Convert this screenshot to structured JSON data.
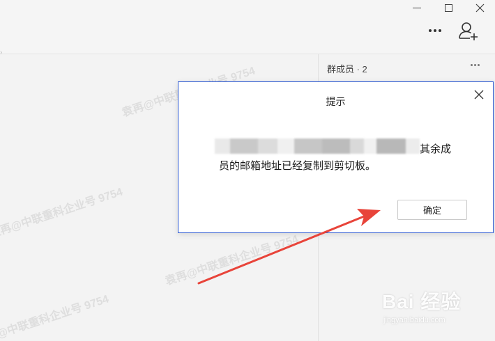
{
  "window": {
    "minimize_icon": "minimize-icon",
    "maximize_icon": "maximize-icon",
    "close_icon": "close-icon"
  },
  "toolbar": {
    "more_icon": "more-horizontal-icon",
    "add_member_icon": "add-member-icon"
  },
  "members_panel": {
    "title": "群成员 · 2"
  },
  "dialog": {
    "title": "提示",
    "message_line1": "其余成",
    "message_line2": "员的邮箱地址已经复制到剪切板。",
    "ok_label": "确定"
  },
  "watermark": {
    "text": "袁再@中联重科企业号 9754"
  },
  "baidu_brand": {
    "name": "Bai  经验",
    "url": "jingyan.baidu.com"
  },
  "colors": {
    "accent_border": "#2f5bd3",
    "arrow": "#e8443a"
  }
}
